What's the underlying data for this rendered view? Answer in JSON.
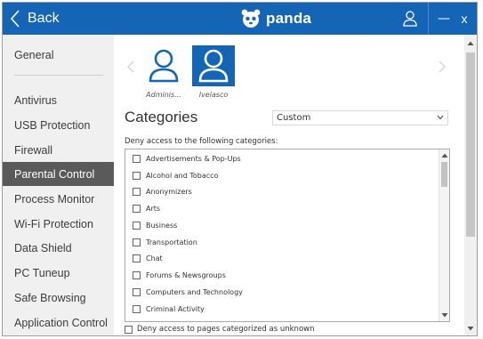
{
  "titlebar": {
    "back_label": "Back",
    "brand": "panda",
    "minimize": "—",
    "close": "x"
  },
  "sidebar": {
    "items": [
      {
        "label": "General"
      },
      {
        "label": "Antivirus"
      },
      {
        "label": "USB Protection"
      },
      {
        "label": "Firewall"
      },
      {
        "label": "Parental Control",
        "active": true
      },
      {
        "label": "Process Monitor"
      },
      {
        "label": "Wi-Fi Protection"
      },
      {
        "label": "Data Shield"
      },
      {
        "label": "PC Tuneup"
      },
      {
        "label": "Safe Browsing"
      },
      {
        "label": "Application Control"
      }
    ]
  },
  "users": [
    {
      "name": "Adminis...",
      "selected": false
    },
    {
      "name": "lvelasco",
      "selected": true
    }
  ],
  "categories": {
    "title": "Categories",
    "mode": "Custom",
    "deny_label": "Deny access to the following categories:",
    "items": [
      {
        "label": "Advertisements & Pop-Ups",
        "checked": false
      },
      {
        "label": "Alcohol and Tobacco",
        "checked": false
      },
      {
        "label": "Anonymizers",
        "checked": false
      },
      {
        "label": "Arts",
        "checked": false
      },
      {
        "label": "Business",
        "checked": false
      },
      {
        "label": "Transportation",
        "checked": false
      },
      {
        "label": "Chat",
        "checked": false
      },
      {
        "label": "Forums & Newsgroups",
        "checked": false
      },
      {
        "label": "Computers and Technology",
        "checked": false
      },
      {
        "label": "Criminal Activity",
        "checked": false
      }
    ],
    "unknown_label": "Deny access to pages categorized as unknown",
    "unknown_checked": false
  },
  "colors": {
    "brand_blue": "#1565b6",
    "sidebar_bg": "#f0f0f0",
    "active_item_bg": "#5a5a5a"
  }
}
